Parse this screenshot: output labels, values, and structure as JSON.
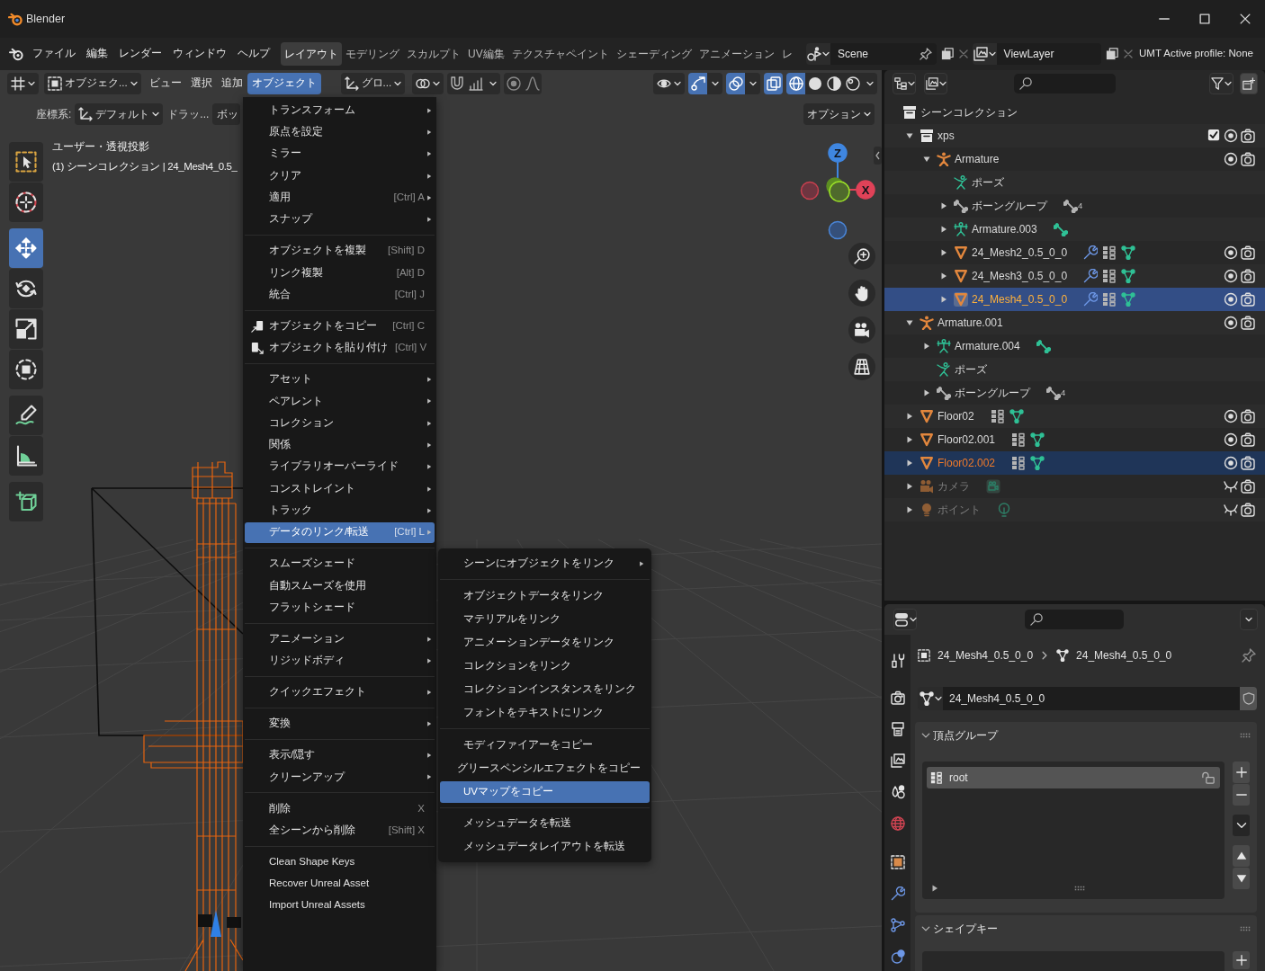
{
  "window": {
    "title": "Blender"
  },
  "topbar": {
    "menus": [
      "ファイル",
      "編集",
      "レンダー",
      "ウィンドウ",
      "ヘルプ"
    ],
    "workspaces": [
      {
        "label": "レイアウト",
        "selected": true
      },
      {
        "label": "モデリング",
        "selected": false
      },
      {
        "label": "スカルプト",
        "selected": false
      },
      {
        "label": "UV編集",
        "selected": false
      },
      {
        "label": "テクスチャペイント",
        "selected": false
      },
      {
        "label": "シェーディング",
        "selected": false
      },
      {
        "label": "アニメーション",
        "selected": false
      },
      {
        "label": "レ",
        "selected": false
      }
    ],
    "scene": "Scene",
    "view_layer": "ViewLayer",
    "status": "UMT Active profile: None"
  },
  "viewport": {
    "header": {
      "mode": "オブジェク...",
      "menus": [
        {
          "label": "ビュー",
          "selected": false
        },
        {
          "label": "選択",
          "selected": false
        },
        {
          "label": "追加",
          "selected": false
        },
        {
          "label": "オブジェクト",
          "selected": true
        }
      ],
      "orientation": "グロ...",
      "snapping": {
        "on": false
      },
      "proportional": {
        "on": false
      },
      "toggles": [
        {
          "kind": "gizmo",
          "on": true
        },
        {
          "kind": "overlay",
          "on": true
        },
        {
          "kind": "xray",
          "on": true
        }
      ],
      "shading": [
        {
          "kind": "wireframe",
          "selected": true
        },
        {
          "kind": "solid",
          "selected": false
        },
        {
          "kind": "material",
          "selected": false
        },
        {
          "kind": "rendered",
          "selected": false
        }
      ]
    },
    "tool_settings": {
      "orientation_label": "座標系:",
      "orientation": "デフォルト",
      "drag_label": "ドラッ...",
      "drag_mode": "ボッ",
      "options": "オプション"
    },
    "tool_groups": [
      [
        {
          "kind": "select_box",
          "selected": false
        },
        {
          "kind": "cursor",
          "selected": false
        }
      ],
      [
        {
          "kind": "move",
          "selected": true
        },
        {
          "kind": "rotate",
          "selected": false
        },
        {
          "kind": "scale",
          "selected": false
        },
        {
          "kind": "transform",
          "selected": false
        }
      ],
      [
        {
          "kind": "annotate",
          "selected": false
        },
        {
          "kind": "measure",
          "selected": false
        }
      ],
      [
        {
          "kind": "add_cube",
          "selected": false
        }
      ]
    ],
    "info": [
      "ユーザー・透視投影",
      "(1) シーンコレクション | 24_Mesh4_0.5_"
    ],
    "gizmo": [
      {
        "kind": "pos_z",
        "label": "Z"
      },
      {
        "kind": "pos_x",
        "label": "X"
      },
      {
        "kind": "neg_x"
      },
      {
        "kind": "neg_z"
      },
      {
        "kind": "pos_y"
      },
      {
        "kind": "neg_y"
      }
    ]
  },
  "object_menu": {
    "sections": [
      {
        "items": [
          {
            "label": "トランスフォーム",
            "submenu": true,
            "selected": false
          },
          {
            "label": "原点を設定",
            "submenu": true,
            "selected": false
          },
          {
            "label": "ミラー",
            "submenu": true,
            "selected": false
          },
          {
            "label": "クリア",
            "submenu": true,
            "selected": false
          },
          {
            "label": "適用",
            "shortcut": "[Ctrl] A",
            "submenu": true,
            "selected": false
          },
          {
            "label": "スナップ",
            "submenu": true,
            "selected": false
          }
        ]
      },
      {
        "items": [
          {
            "label": "オブジェクトを複製",
            "shortcut": "[Shift] D",
            "submenu": false,
            "selected": false
          },
          {
            "label": "リンク複製",
            "shortcut": "[Alt] D",
            "submenu": false,
            "selected": false
          },
          {
            "label": "統合",
            "shortcut": "[Ctrl] J",
            "submenu": false,
            "selected": false
          }
        ]
      },
      {
        "items": [
          {
            "label": "オブジェクトをコピー",
            "kind": "copy",
            "shortcut": "[Ctrl] C",
            "submenu": false,
            "selected": false
          },
          {
            "label": "オブジェクトを貼り付け",
            "kind": "paste",
            "shortcut": "[Ctrl] V",
            "submenu": false,
            "selected": false
          }
        ]
      },
      {
        "items": [
          {
            "label": "アセット",
            "submenu": true,
            "selected": false
          },
          {
            "label": "ペアレント",
            "submenu": true,
            "selected": false
          },
          {
            "label": "コレクション",
            "submenu": true,
            "selected": false
          },
          {
            "label": "関係",
            "submenu": true,
            "selected": false
          },
          {
            "label": "ライブラリオーバーライド",
            "submenu": true,
            "selected": false
          },
          {
            "label": "コンストレイント",
            "submenu": true,
            "selected": false
          },
          {
            "label": "トラック",
            "submenu": true,
            "selected": false
          },
          {
            "label": "データのリンク/転送",
            "shortcut": "[Ctrl] L",
            "submenu": true,
            "selected": true
          }
        ]
      },
      {
        "items": [
          {
            "label": "スムーズシェード",
            "submenu": false,
            "selected": false
          },
          {
            "label": "自動スムーズを使用",
            "submenu": false,
            "selected": false
          },
          {
            "label": "フラットシェード",
            "submenu": false,
            "selected": false
          }
        ]
      },
      {
        "items": [
          {
            "label": "アニメーション",
            "submenu": true,
            "selected": false
          },
          {
            "label": "リジッドボディ",
            "submenu": true,
            "selected": false
          }
        ]
      },
      {
        "items": [
          {
            "label": "クイックエフェクト",
            "submenu": true,
            "selected": false
          }
        ]
      },
      {
        "items": [
          {
            "label": "変換",
            "submenu": true,
            "selected": false
          }
        ]
      },
      {
        "items": [
          {
            "label": "表示/隠す",
            "submenu": true,
            "selected": false
          },
          {
            "label": "クリーンアップ",
            "submenu": true,
            "selected": false
          }
        ]
      },
      {
        "items": [
          {
            "label": "削除",
            "shortcut": "X",
            "submenu": false,
            "selected": false
          },
          {
            "label": "全シーンから削除",
            "shortcut": "[Shift] X",
            "submenu": false,
            "selected": false
          }
        ]
      },
      {
        "items": [
          {
            "label": "Clean Shape Keys",
            "submenu": false,
            "selected": false
          },
          {
            "label": "Recover Unreal Asset",
            "submenu": false,
            "selected": false
          },
          {
            "label": "Import Unreal Assets",
            "submenu": false,
            "selected": false
          }
        ]
      }
    ]
  },
  "link_menu": {
    "sections": [
      {
        "items": [
          {
            "label": "シーンにオブジェクトをリンク",
            "submenu": true,
            "selected": false
          }
        ]
      },
      {
        "items": [
          {
            "label": "オブジェクトデータをリンク",
            "submenu": false,
            "selected": false
          },
          {
            "label": "マテリアルをリンク",
            "submenu": false,
            "selected": false
          },
          {
            "label": "アニメーションデータをリンク",
            "submenu": false,
            "selected": false
          },
          {
            "label": "コレクションをリンク",
            "submenu": false,
            "selected": false
          },
          {
            "label": "コレクションインスタンスをリンク",
            "submenu": false,
            "selected": false
          },
          {
            "label": "フォントをテキストにリンク",
            "submenu": false,
            "selected": false
          }
        ]
      },
      {
        "items": [
          {
            "label": "モディファイアーをコピー",
            "submenu": false,
            "selected": false
          },
          {
            "label": "グリースペンシルエフェクトをコピー",
            "submenu": false,
            "selected": false
          },
          {
            "label": "UVマップをコピー",
            "submenu": false,
            "selected": true
          }
        ]
      },
      {
        "items": [
          {
            "label": "メッシュデータを転送",
            "submenu": false,
            "selected": false
          },
          {
            "label": "メッシュデータレイアウトを転送",
            "submenu": false,
            "selected": false
          }
        ]
      }
    ]
  },
  "outliner": {
    "tree": [
      {
        "label": "シーンコレクション",
        "kind": "scene_collection",
        "selected": false,
        "active": false,
        "hidden": false,
        "children": [
          {
            "label": "xps",
            "kind": "collection",
            "expanded": true,
            "selected": false,
            "active": false,
            "hidden": false,
            "checked": true,
            "children": [
              {
                "label": "Armature",
                "kind": "armature",
                "expanded": true,
                "selected": false,
                "active": false,
                "hidden": false,
                "children": [
                  {
                    "label": "ポーズ",
                    "kind": "pose",
                    "selected": false,
                    "active": false,
                    "hidden": false
                  },
                  {
                    "label": "ボーングループ",
                    "kind": "bone_groups",
                    "expanded": false,
                    "selected": false,
                    "active": false,
                    "hidden": false,
                    "extras": [
                      {
                        "kind": "bone_groups",
                        "count": "4"
                      }
                    ]
                  },
                  {
                    "label": "Armature.003",
                    "kind": "armature_data",
                    "expanded": false,
                    "selected": false,
                    "active": false,
                    "hidden": false,
                    "extras": [
                      {
                        "kind": "bone"
                      }
                    ]
                  },
                  {
                    "label": "24_Mesh2_0.5_0_0",
                    "kind": "mesh",
                    "expanded": false,
                    "selected": false,
                    "active": false,
                    "hidden": false,
                    "extras": [
                      {
                        "kind": "modifier"
                      },
                      {
                        "kind": "vertex_groups"
                      },
                      {
                        "kind": "mesh_data"
                      }
                    ]
                  },
                  {
                    "label": "24_Mesh3_0.5_0_0",
                    "kind": "mesh",
                    "expanded": false,
                    "selected": false,
                    "active": false,
                    "hidden": false,
                    "extras": [
                      {
                        "kind": "modifier"
                      },
                      {
                        "kind": "vertex_groups"
                      },
                      {
                        "kind": "mesh_data"
                      }
                    ]
                  },
                  {
                    "label": "24_Mesh4_0.5_0_0",
                    "kind": "mesh",
                    "expanded": false,
                    "selected": true,
                    "active": true,
                    "hidden": false,
                    "extras": [
                      {
                        "kind": "modifier"
                      },
                      {
                        "kind": "vertex_groups"
                      },
                      {
                        "kind": "mesh_data"
                      }
                    ]
                  }
                ]
              }
            ]
          },
          {
            "label": "Armature.001",
            "kind": "armature",
            "expanded": true,
            "selected": false,
            "active": false,
            "hidden": false,
            "children": [
              {
                "label": "Armature.004",
                "kind": "armature_data",
                "expanded": false,
                "selected": false,
                "active": false,
                "hidden": false,
                "extras": [
                  {
                    "kind": "bone"
                  }
                ]
              },
              {
                "label": "ポーズ",
                "kind": "pose",
                "selected": false,
                "active": false,
                "hidden": false
              },
              {
                "label": "ボーングループ",
                "kind": "bone_groups",
                "expanded": false,
                "selected": false,
                "active": false,
                "hidden": false,
                "extras": [
                  {
                    "kind": "bone_groups",
                    "count": "4"
                  }
                ]
              }
            ]
          },
          {
            "label": "Floor02",
            "kind": "mesh",
            "expanded": false,
            "selected": false,
            "active": false,
            "hidden": false,
            "extras": [
              {
                "kind": "vertex_groups"
              },
              {
                "kind": "mesh_data"
              }
            ]
          },
          {
            "label": "Floor02.001",
            "kind": "mesh",
            "expanded": false,
            "selected": false,
            "active": false,
            "hidden": false,
            "extras": [
              {
                "kind": "vertex_groups"
              },
              {
                "kind": "mesh_data"
              }
            ]
          },
          {
            "label": "Floor02.002",
            "kind": "mesh",
            "expanded": false,
            "selected": true,
            "active": false,
            "hidden": false,
            "extras": [
              {
                "kind": "vertex_groups"
              },
              {
                "kind": "mesh_data"
              }
            ]
          },
          {
            "label": "カメラ",
            "kind": "camera",
            "expanded": false,
            "selected": false,
            "active": false,
            "hidden": true,
            "extras": [
              {
                "kind": "camera_data"
              }
            ]
          },
          {
            "label": "ポイント",
            "kind": "light",
            "expanded": false,
            "selected": false,
            "active": false,
            "hidden": true,
            "extras": [
              {
                "kind": "light_data"
              }
            ]
          }
        ]
      }
    ]
  },
  "properties": {
    "breadcrumb": [
      "24_Mesh4_0.5_0_0",
      "24_Mesh4_0.5_0_0"
    ],
    "datablock": "24_Mesh4_0.5_0_0",
    "panels": [
      {
        "kind": "vertex_groups",
        "title": "頂点グループ",
        "expanded": true,
        "items": [
          {
            "label": "root",
            "selected": true,
            "locked": false
          }
        ]
      },
      {
        "kind": "shape_keys",
        "title": "シェイプキー",
        "expanded": true
      }
    ]
  }
}
